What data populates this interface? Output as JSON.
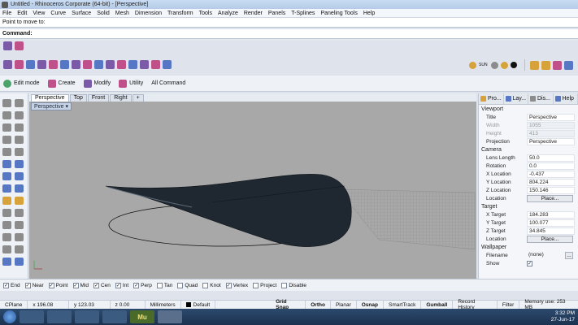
{
  "window": {
    "title": "Untitled - Rhinoceros Corporate (64-bit) - [Perspective]"
  },
  "menu": [
    "File",
    "Edit",
    "View",
    "Curve",
    "Surface",
    "Solid",
    "Mesh",
    "Dimension",
    "Transform",
    "Tools",
    "Analyze",
    "Render",
    "Panels",
    "T-Splines",
    "Paneling Tools",
    "Help"
  ],
  "command": {
    "history": "Point to move to:",
    "prompt": "Command:"
  },
  "tabs": {
    "edit_mode": "Edit mode",
    "create": "Create",
    "modify": "Modify",
    "utility": "Utility",
    "all_command": "All Command"
  },
  "toolbar_icons": [
    "tspline-box-icon",
    "tspline-sphere-icon",
    "tspline-plane-icon",
    "tspline-cylinder-icon",
    "tspline-extrude-icon",
    "tspline-append-icon",
    "tspline-weld-icon",
    "tspline-bridge-icon",
    "tspline-crease-icon",
    "tspline-fill-icon",
    "tspline-delete-icon",
    "tspline-symmetry-icon",
    "tspline-convert-icon",
    "tspline-match-icon",
    "tspline-smooth-icon"
  ],
  "sun_label": "SUN",
  "viewport_tabs": [
    "Perspective",
    "Top",
    "Front",
    "Right"
  ],
  "viewport": {
    "label": "Perspective"
  },
  "properties": {
    "tabs": [
      "Pro...",
      "Lay...",
      "Dis...",
      "Help"
    ],
    "viewport_section": "Viewport",
    "title_label": "Title",
    "title_value": "Perspective",
    "width_label": "Width",
    "width_value": "1055",
    "height_label": "Height",
    "height_value": "413",
    "projection_label": "Projection",
    "projection_value": "Perspective",
    "camera_section": "Camera",
    "lens_label": "Lens Length",
    "lens_value": "50.0",
    "rotation_label": "Rotation",
    "rotation_value": "0.0",
    "xloc_label": "X Location",
    "xloc_value": "-0.437",
    "yloc_label": "Y Location",
    "yloc_value": "804.224",
    "zloc_label": "Z Location",
    "zloc_value": "150.146",
    "location_label": "Location",
    "place_button": "Place...",
    "target_section": "Target",
    "xtarget_label": "X Target",
    "xtarget_value": "184.283",
    "ytarget_label": "Y Target",
    "ytarget_value": "100.077",
    "ztarget_label": "Z Target",
    "ztarget_value": "34.845",
    "target_location_label": "Location",
    "target_place_button": "Place...",
    "wallpaper_section": "Wallpaper",
    "filename_label": "Filename",
    "filename_value": "(none)",
    "browse_button": "...",
    "show_label": "Show"
  },
  "osnaps": [
    {
      "label": "End",
      "checked": true
    },
    {
      "label": "Near",
      "checked": true
    },
    {
      "label": "Point",
      "checked": true
    },
    {
      "label": "Mid",
      "checked": true
    },
    {
      "label": "Cen",
      "checked": true
    },
    {
      "label": "Int",
      "checked": true
    },
    {
      "label": "Perp",
      "checked": true
    },
    {
      "label": "Tan",
      "checked": false
    },
    {
      "label": "Quad",
      "checked": false
    },
    {
      "label": "Knot",
      "checked": false
    },
    {
      "label": "Vertex",
      "checked": true
    },
    {
      "label": "Project",
      "checked": false
    },
    {
      "label": "Disable",
      "checked": false
    }
  ],
  "status": {
    "cplane": "CPlane",
    "x": "x 196.08",
    "y": "y 123.03",
    "z": "z 0.00",
    "units": "Millimeters",
    "layer": "Default",
    "grid_snap": "Grid Snap",
    "ortho": "Ortho",
    "planar": "Planar",
    "osnap": "Osnap",
    "smarttrack": "SmartTrack",
    "gumball": "Gumball",
    "record_history": "Record History",
    "filter": "Filter",
    "memory": "Memory use: 253 MB"
  },
  "taskbar": {
    "time": "3:32 PM",
    "date": "27-Jun-17",
    "mu_label": "Mu"
  },
  "colors": {
    "surface": "#1f2731",
    "viewport_bg": "#a8a8a8",
    "accent": "#5677c4"
  }
}
